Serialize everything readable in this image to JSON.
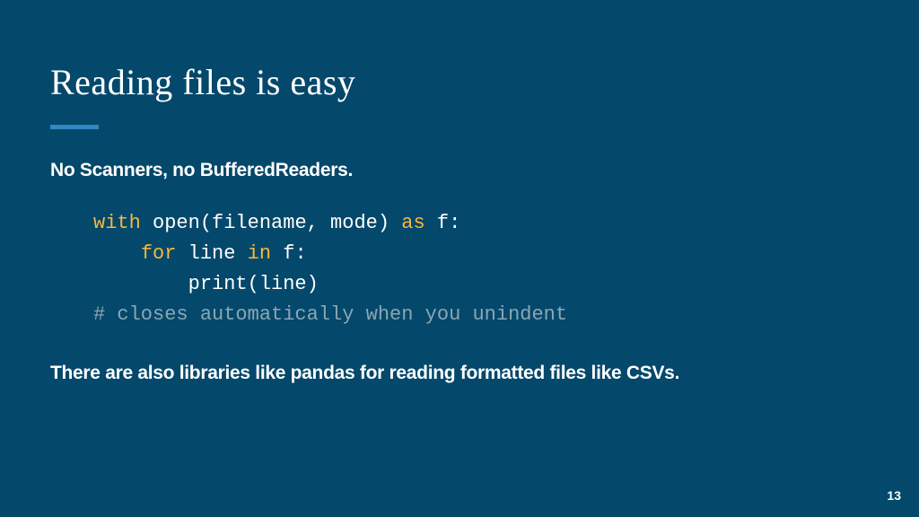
{
  "slide": {
    "title": "Reading files is easy",
    "subhead": "No Scanners, no BufferedReaders.",
    "code": {
      "line1": {
        "kw1": "with",
        "mid": " open(filename, mode) ",
        "kw2": "as",
        "tail": " f:"
      },
      "line2": {
        "indent": "    ",
        "kw1": "for",
        "mid1": " line ",
        "kw2": "in",
        "mid2": " f:"
      },
      "line3": "        print(line)",
      "line4": "# closes automatically when you unindent"
    },
    "footnote": "There are also libraries like pandas for reading formatted files like CSVs.",
    "page_number": "13"
  }
}
